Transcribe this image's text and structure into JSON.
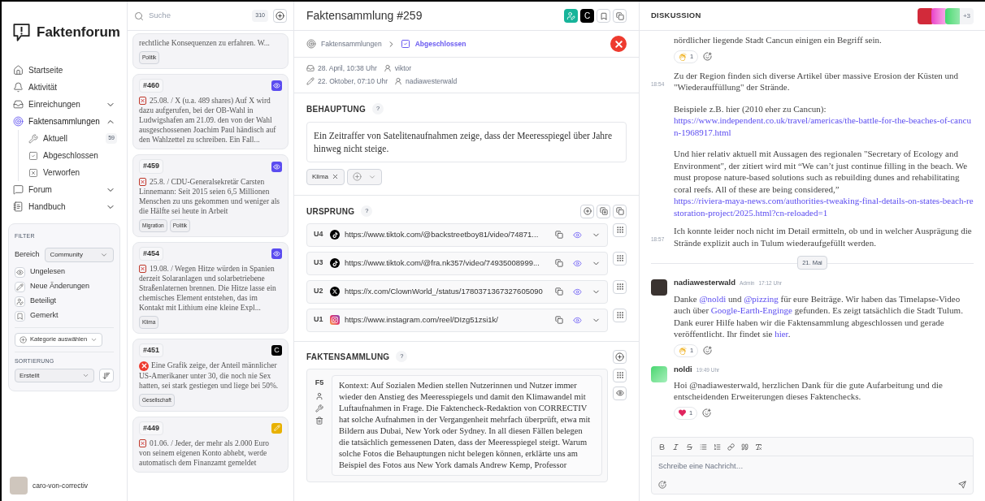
{
  "app": {
    "name": "Faktenforum"
  },
  "nav": {
    "items": [
      {
        "label": "Startseite",
        "selected": false
      },
      {
        "label": "Aktivität",
        "selected": false
      },
      {
        "label": "Einreichungen",
        "selected": false,
        "expanded": false
      },
      {
        "label": "Faktensammlungen",
        "selected": true,
        "expanded": true,
        "children": [
          {
            "label": "Aktuell",
            "badge": "59"
          },
          {
            "label": "Abgeschlossen"
          },
          {
            "label": "Verworfen"
          }
        ]
      },
      {
        "label": "Forum",
        "selected": false,
        "expanded": false
      },
      {
        "label": "Handbuch",
        "selected": false,
        "expanded": false
      }
    ]
  },
  "filter": {
    "title": "FILTER",
    "scope_label": "Bereich",
    "scope_value": "Community",
    "toggles": [
      "Ungelesen",
      "Neue Änderungen",
      "Beteiligt",
      "Gemerkt"
    ],
    "category_button": "Kategorie auswählen",
    "sort_title": "SORTIERUNG",
    "sort_value": "Erstellt"
  },
  "user": {
    "name": "caro-von-correctiv"
  },
  "list": {
    "search_placeholder": "Suche",
    "count": "310",
    "cards": [
      {
        "text": "rechtliche Konsequenzen zu erfahren. W...",
        "tags": [
          "Politik"
        ]
      },
      {
        "number": "#460",
        "badge": {
          "kind": "eye"
        },
        "rating": {
          "kind": "rated"
        },
        "text": "25.08. / X (u.a. 489 shares) Auf X wird dazu aufgerufen, bei der OB-Wahl in Ludwigshafen am 21.09. den von der Wahl ausgeschossenen Joachim Paul händisch auf den Wahlzettel zu schreiben. Ein Fall..."
      },
      {
        "number": "#459",
        "badge": {
          "kind": "eye"
        },
        "rating": {
          "kind": "rated"
        },
        "text": "25.8. / CDU-Generalsekretär Carsten Linnemann: Seit 2015 seien 6,5 Millionen Menschen zu uns gekommen und weniger als die Hälfte sei heute in Arbeit",
        "tags": [
          "Migration",
          "Politik"
        ]
      },
      {
        "number": "#454",
        "badge": {
          "kind": "eye"
        },
        "rating": {
          "kind": "rated"
        },
        "text": "19.08. / Wegen Hitze würden in Spanien derzeit Solaranlagen und solarbetriebene Straßenlaternen brennen. Die Hitze lasse ein chemisches Element entstehen, das im Kontakt mit Lithium eine kleine Expl...",
        "tags": [
          "Klima"
        ]
      },
      {
        "number": "#451",
        "badge": {
          "kind": "letter",
          "text": "C"
        },
        "rating": {
          "kind": "false"
        },
        "text": "Eine Grafik zeige, der Anteil männlicher US-Amerikaner unter 30, die noch nie Sex hatten, sei stark gestiegen und liege bei 50%.",
        "tags": [
          "Gesellschaft"
        ]
      },
      {
        "number": "#449",
        "badge": {
          "kind": "edit"
        },
        "rating": {
          "kind": "rated"
        },
        "text": "01.06. / Jeder, der mehr als 2.000 Euro von seinem eigenen Konto abhebt, werde automatisch dem Finanzamt gemeldet"
      }
    ]
  },
  "main": {
    "title": "Faktensammlung #259",
    "badge_text": "C",
    "breadcrumb": [
      "Faktensammlungen",
      "Abgeschlossen"
    ],
    "verdict": {
      "kind": "false"
    },
    "meta": [
      {
        "kind": "submitted",
        "date": "28. April, 10:38 Uhr",
        "user": "viktor"
      },
      {
        "kind": "edited",
        "date": "22. Oktober, 07:10 Uhr",
        "user": "nadiawesterwald"
      }
    ],
    "claim": {
      "title": "BEHAUPTUNG",
      "help": "?",
      "text": "Ein Zeitraffer von Satelitenaufnahmen zeige, dass der Meeresspiegel über Jahre hinweg nicht steige.",
      "tags": [
        "Klima"
      ]
    },
    "origin": {
      "title": "URSPRUNG",
      "help": "?",
      "sources": [
        {
          "id": "U4",
          "kind": "tiktok",
          "url": "https://www.tiktok.com/@backstreetboy81/video/74871..."
        },
        {
          "id": "U3",
          "kind": "tiktok",
          "url": "https://www.tiktok.com/@fra.nk357/video/74935008999..."
        },
        {
          "id": "U2",
          "kind": "x",
          "url": "https://x.com/ClownWorld_/status/1780371367327605090"
        },
        {
          "id": "U1",
          "kind": "instagram",
          "url": "https://www.instagram.com/reel/DIzg51zsi1k/"
        }
      ]
    },
    "facts": {
      "title": "FAKTENSAMMLUNG",
      "help": "?",
      "items": [
        {
          "id": "F5",
          "text": "Kontext: Auf Sozialen Medien stellen Nutzerinnen und Nutzer immer wieder den Anstieg des Meeresspiegels und damit den Klimawandel mit Luftaufnahmen in Frage. Die Faktencheck-Redaktion von CORRECTIV hat solche Aufnahmen in der Vergangenheit mehrfach überprüft, etwa mit Bildern aus Dubai, New York oder Sydney. In all diesen Fällen belegen die tatsächlich gemessenen Daten, dass der Meeresspiegel steigt. Warum solche Fotos die Behauptungen nicht belegen können, erklärte uns am Beispiel des Fotos aus New York damals Andrew Kemp, Professor"
        }
      ]
    }
  },
  "discussion": {
    "title": "DISKUSSION",
    "more": "+3",
    "entries": [
      {
        "kind": "message",
        "paragraphs": [
          [
            {
              "kind": "text",
              "text": "nördlicher liegende Stadt Cancun einigen ein Begriff sein."
            }
          ]
        ],
        "reactions": [
          {
            "kind": "clap",
            "count": "1"
          }
        ]
      },
      {
        "kind": "message",
        "time": "18:54",
        "paragraphs": [
          [
            {
              "kind": "text",
              "text": "Zu der Region finden sich diverse Artikel über massive Erosion der Küsten und \"Wiederauffüllung\" der Strände."
            }
          ],
          [
            {
              "kind": "text",
              "text": "Beispiele z.B. hier (2010 eher zu Cancun):"
            },
            {
              "kind": "link",
              "text": "https://www.independent.co.uk/travel/americas/the-battle-for-the-beaches-of-cancun-1968917.html"
            }
          ],
          [
            {
              "kind": "text",
              "text": "Und hier relativ aktuell mit Aussagen des regionalen \"Secretary of Ecology and Environment\", der zitiert wird mit “We can’t just continue filling in the beach. We must propose nature-based solutions such as rebuilding dunes and rehabilitating coral reefs. All of these are being considered,”"
            },
            {
              "kind": "link",
              "text": "https://riviera-maya-news.com/authorities-tweaking-final-details-on-states-beach-restoration-project/2025.html?cn-reloaded=1"
            }
          ]
        ]
      },
      {
        "kind": "message",
        "time": "18:57",
        "paragraphs": [
          [
            {
              "kind": "text",
              "text": "Ich konnte leider noch nicht im Detail ermitteln, ob und in welcher Ausprägung die Strände explizit auch in Tulum wiederaufgefüllt werden."
            }
          ]
        ]
      },
      {
        "kind": "date",
        "text": "21. Mai"
      },
      {
        "kind": "message",
        "author": "nadiawesterwald",
        "avatar": {
          "kind": "photo"
        },
        "role": "Admin",
        "time": "17:12 Uhr",
        "paragraphs": [
          [
            {
              "kind": "rich",
              "segments": [
                {
                  "text": "Danke ",
                  "link": false
                },
                {
                  "text": "@noldi",
                  "link": true
                },
                {
                  "text": " und ",
                  "link": false
                },
                {
                  "text": "@pizzing",
                  "link": true
                },
                {
                  "text": " für eure Beiträge. Wir haben das Timelapse-Video auch über ",
                  "link": false
                },
                {
                  "text": "Google-Earth-Enginge",
                  "link": true
                },
                {
                  "text": " gefunden. Es zeigt tatsächlich die Stadt Tulum. Dank eurer Hilfe haben wir die Faktensammlung abgeschlossen und gerade veröffentlicht. Ihr findet sie ",
                  "link": false
                },
                {
                  "text": "hier",
                  "link": true
                },
                {
                  "text": ".",
                  "link": false
                }
              ]
            }
          ]
        ],
        "reactions": [
          {
            "kind": "clap",
            "count": "1"
          }
        ]
      },
      {
        "kind": "message",
        "author": "noldi",
        "avatar": {
          "kind": "gradient"
        },
        "time": "19:49 Uhr",
        "paragraphs": [
          [
            {
              "kind": "text",
              "text": "Hoi @nadiawesterwald, herzlichen Dank für die gute Aufarbeitung und die entscheidenden Erweiterungen dieses Faktenchecks."
            }
          ]
        ],
        "reactions": [
          {
            "kind": "heart",
            "count": "1"
          }
        ]
      }
    ],
    "composer": {
      "placeholder": "Schreibe eine Nachricht…"
    }
  }
}
